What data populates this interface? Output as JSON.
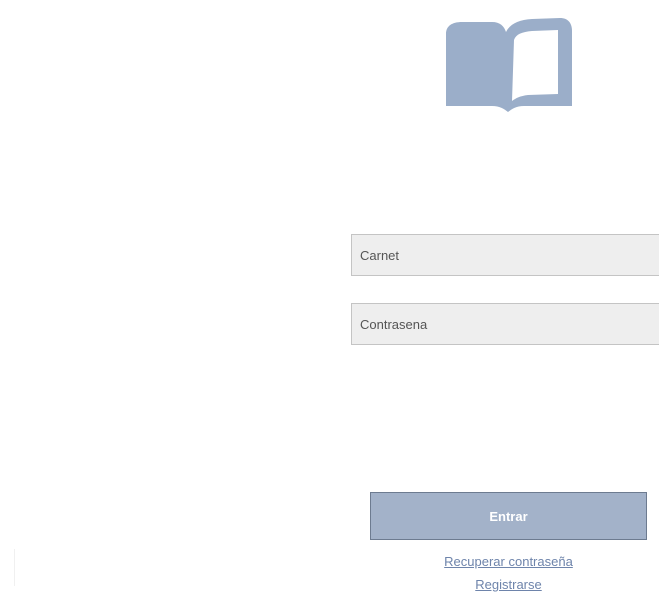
{
  "logo": {
    "icon": "open-book-icon",
    "color": "#9baec9"
  },
  "login": {
    "carnet_placeholder": "Carnet",
    "password_placeholder": "Contrasena",
    "submit_label": "Entrar",
    "recover_link": "Recuperar contraseña",
    "register_link": "Registrarse"
  },
  "colors": {
    "button_bg": "#a3b2c9",
    "field_bg": "#eeeeee",
    "link": "#6e84ab"
  }
}
